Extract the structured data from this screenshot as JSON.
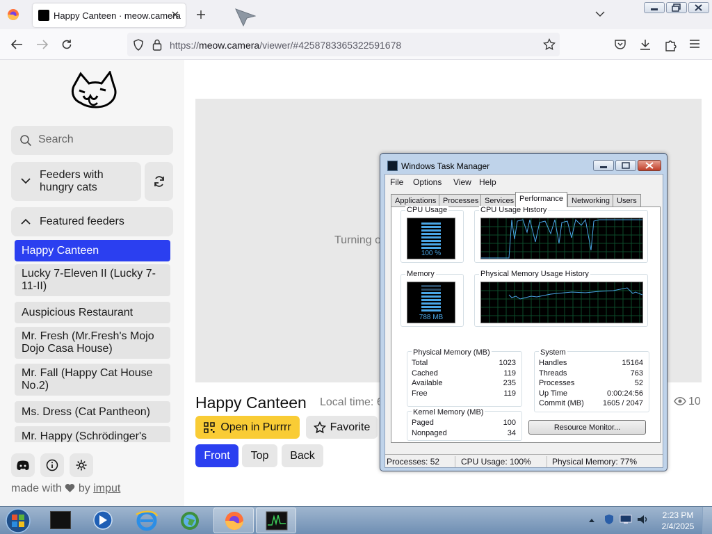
{
  "browser": {
    "tab_title": "Happy Canteen · meow.camera",
    "url_prefix": "https://",
    "url_host": "meow.camera",
    "url_path": "/viewer/#4258783365322591678"
  },
  "sidebar": {
    "search_placeholder": "Search",
    "feeders_toggle_label": "Feeders with hungry cats",
    "featured_label": "Featured feeders",
    "feeders": [
      {
        "label": "Happy Canteen"
      },
      {
        "label": "Lucky 7-Eleven II (Lucky 7-11-II)"
      },
      {
        "label": "Auspicious Restaurant"
      },
      {
        "label": "Mr. Fresh (Mr.Fresh's Mojo Dojo Casa House)"
      },
      {
        "label": "Mr. Fall (Happy Cat House No.2)"
      },
      {
        "label": "Ms. Dress (Cat Pantheon)"
      },
      {
        "label": "Mr. Happy (Schrödinger's"
      }
    ],
    "made_with": "made with",
    "by": "by",
    "author": "imput",
    "accent": "#2b3ff0"
  },
  "main": {
    "status_text": "Turning o",
    "feeder_title": "Happy Canteen",
    "local_time_label": "Local time: 6",
    "viewers": "10",
    "open_purrrr": "Open in Purrrr",
    "favorite": "Favorite",
    "camera_views": [
      "Front",
      "Top",
      "Back"
    ],
    "active_view": "Front"
  },
  "task_manager": {
    "title": "Windows Task Manager",
    "menu": [
      "File",
      "Options",
      "View",
      "Help"
    ],
    "tabs": [
      "Applications",
      "Processes",
      "Services",
      "Performance",
      "Networking",
      "Users"
    ],
    "active_tab": "Performance",
    "cpu_usage_label": "CPU Usage",
    "cpu_usage_value": "100 %",
    "cpu_history_label": "CPU Usage History",
    "memory_label": "Memory",
    "memory_value": "788 MB",
    "mem_history_label": "Physical Memory Usage History",
    "physical_memory": {
      "label": "Physical Memory (MB)",
      "rows": [
        [
          "Total",
          "1023"
        ],
        [
          "Cached",
          "119"
        ],
        [
          "Available",
          "235"
        ],
        [
          "Free",
          "119"
        ]
      ]
    },
    "kernel_memory": {
      "label": "Kernel Memory (MB)",
      "rows": [
        [
          "Paged",
          "100"
        ],
        [
          "Nonpaged",
          "34"
        ]
      ]
    },
    "system": {
      "label": "System",
      "rows": [
        [
          "Handles",
          "15164"
        ],
        [
          "Threads",
          "763"
        ],
        [
          "Processes",
          "52"
        ],
        [
          "Up Time",
          "0:00:24:56"
        ],
        [
          "Commit (MB)",
          "1605 / 2047"
        ]
      ]
    },
    "resource_monitor": "Resource Monitor...",
    "status": {
      "processes": "Processes: 52",
      "cpu": "CPU Usage: 100%",
      "memory": "Physical Memory: 77%"
    }
  },
  "taskbar": {
    "time": "2:23 PM",
    "date": "2/4/2025"
  }
}
